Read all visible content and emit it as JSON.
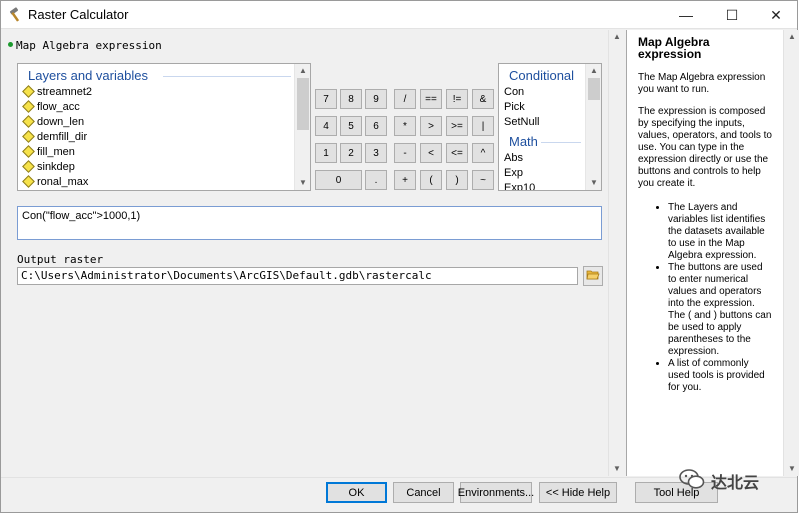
{
  "window": {
    "title": "Raster Calculator",
    "minimize_glyph": "—",
    "maximize_glyph": "☐",
    "close_glyph": "✕"
  },
  "expression_section": {
    "label": "Map Algebra expression"
  },
  "layers": {
    "header": "Layers and variables",
    "items": [
      "streamnet2",
      "flow_acc",
      "down_len",
      "demfill_dir",
      "fill_men",
      "sinkdep",
      "ronal_max"
    ]
  },
  "calculator": {
    "row1": [
      "7",
      "8",
      "9",
      "/",
      "==",
      "!=",
      "&"
    ],
    "row2": [
      "4",
      "5",
      "6",
      "*",
      ">",
      ">=",
      "|"
    ],
    "row3": [
      "1",
      "2",
      "3",
      "-",
      "<",
      "<=",
      "^"
    ],
    "row4": [
      "0",
      ".",
      "+",
      "(",
      ")",
      "~"
    ]
  },
  "functions": {
    "conditional_header": "Conditional",
    "conditional_items": [
      "Con",
      "Pick",
      "SetNull"
    ],
    "math_header": "Math",
    "math_items": [
      "Abs",
      "Exp",
      "Exp10"
    ]
  },
  "expression_value": "Con(\"flow_acc\">1000,1)",
  "output": {
    "label": "Output raster",
    "value": "C:\\Users\\Administrator\\Documents\\ArcGIS\\Default.gdb\\rastercalc"
  },
  "help": {
    "title": "Map Algebra expression",
    "para1": "The Map Algebra expression you want to run.",
    "para2": "The expression is composed by specifying the inputs, values, operators, and tools to use. You can type in the expression directly or use the buttons and controls to help you create it.",
    "bullets": [
      "The Layers and variables list identifies the datasets available to use in the Map Algebra expression.",
      "The buttons are used to enter numerical values and operators into the expression. The ( and ) buttons can be used to apply parentheses to the expression.",
      "A list of commonly used tools is provided for you."
    ]
  },
  "buttons": {
    "ok": "OK",
    "cancel": "Cancel",
    "environments": "Environments...",
    "hide_help": "<< Hide Help",
    "tool_help": "Tool Help"
  },
  "watermark": "达北云",
  "colors": {
    "accent": "#1e4f9e",
    "layer_icon": "#f6e24a",
    "required_dot": "#1c9a2e"
  }
}
